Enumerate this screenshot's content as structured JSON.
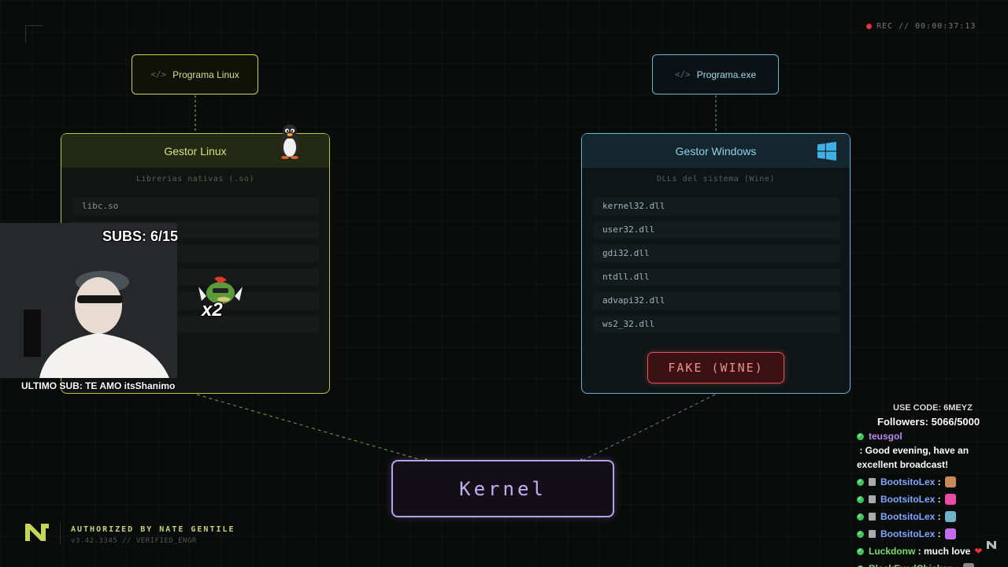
{
  "rec": {
    "label": "REC // 00:00:37:13"
  },
  "linux": {
    "program": {
      "code": "</>",
      "label": "Programa Linux"
    },
    "panel": {
      "title": "Gestor Linux",
      "subtitle": "Librerias nativas (.so)",
      "libs": [
        "libc.so",
        "",
        "",
        "",
        "",
        ""
      ]
    }
  },
  "windows": {
    "program": {
      "code": "</>",
      "label": "Programa.exe"
    },
    "panel": {
      "title": "Gestor Windows",
      "subtitle": "DLLs del sistema (Wine)",
      "libs": [
        "kernel32.dll",
        "user32.dll",
        "gdi32.dll",
        "ntdll.dll",
        "advapi32.dll",
        "ws2_32.dll"
      ],
      "fake_button": "FAKE (WINE)"
    }
  },
  "kernel": {
    "label": "Kernel"
  },
  "stream": {
    "subs": "SUBS: 6/15",
    "ultimo_sub": "ULTIMO SUB: TE AMO itsShanimo",
    "emote_text": "x2",
    "use_code": "USE CODE: 6MEYZ",
    "followers": "Followers: 5066/5000"
  },
  "brand": {
    "authorized": "AUTHORIZED BY NATE GENTILE",
    "version": "v3.42.3345 // VERIFIED_ENGR"
  },
  "chat": [
    {
      "user": "teusgol",
      "text": ": Good evening, have an excellent broadcast!",
      "color": "#b98cf0",
      "mod": false
    },
    {
      "user": "BootsitoLex",
      "text": ":",
      "color": "#7ea7ff",
      "mod": true,
      "emoji": "#c98a5a"
    },
    {
      "user": "BootsitoLex",
      "text": ":",
      "color": "#7ea7ff",
      "mod": true,
      "emoji": "#e94ca3"
    },
    {
      "user": "BootsitoLex",
      "text": ":",
      "color": "#7ea7ff",
      "mod": true,
      "emoji": "#6fb2c7"
    },
    {
      "user": "BootsitoLex",
      "text": ":",
      "color": "#7ea7ff",
      "mod": true,
      "emoji": "#c46cf0"
    },
    {
      "user": "Luckdonw",
      "text": ": much love",
      "color": "#7bdc6a",
      "mod": false,
      "heart": "❤"
    },
    {
      "user": "BlackEyedChicken",
      "text": ":",
      "color": "#7bdc6a",
      "mod": false,
      "emoji": "#888888"
    }
  ],
  "colors": {
    "linux_accent": "#b7c64a",
    "windows_accent": "#64b3d6",
    "kernel_accent": "#b8a0f0",
    "fake_accent": "#e0545a"
  }
}
